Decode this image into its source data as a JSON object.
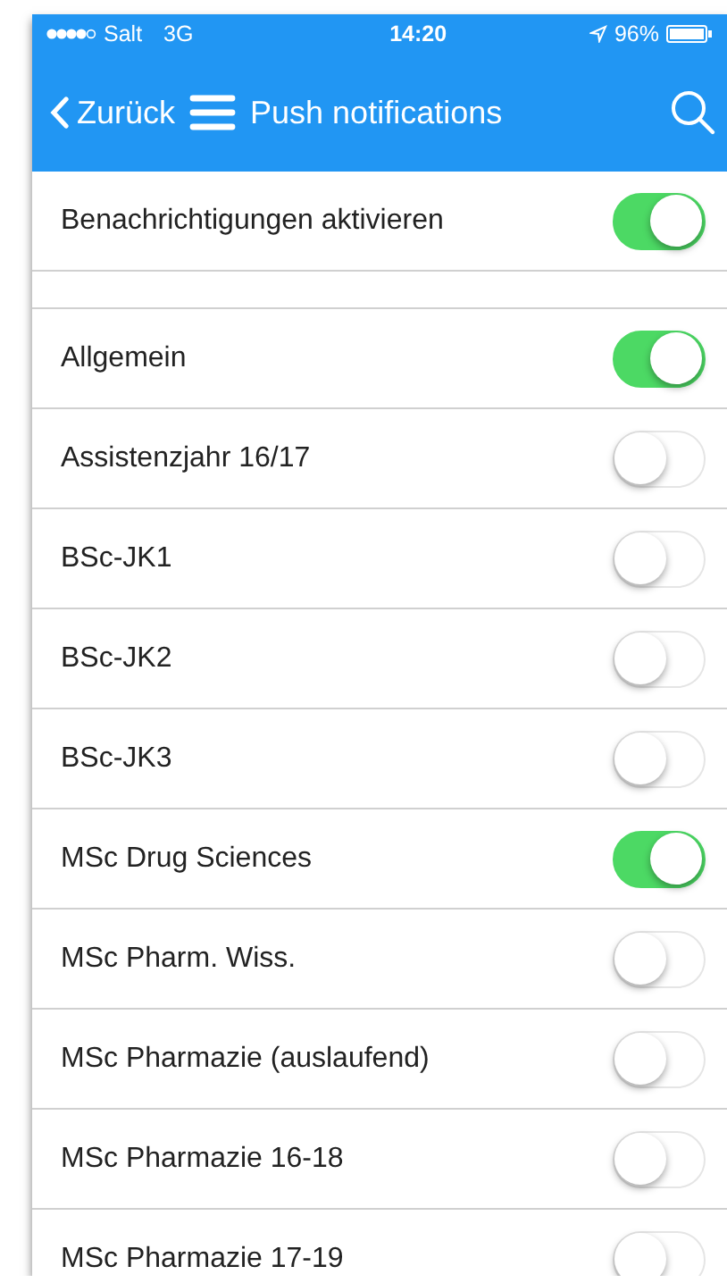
{
  "status_bar": {
    "carrier": "Salt",
    "network": "3G",
    "time": "14:20",
    "battery": "96%"
  },
  "header": {
    "back": "Zurück",
    "title": "Push notifications"
  },
  "master": {
    "label": "Benachrichtigungen aktivieren",
    "on": true
  },
  "channels": [
    {
      "label": "Allgemein",
      "on": true
    },
    {
      "label": "Assistenzjahr 16/17",
      "on": false
    },
    {
      "label": "BSc-JK1",
      "on": false
    },
    {
      "label": "BSc-JK2",
      "on": false
    },
    {
      "label": "BSc-JK3",
      "on": false
    },
    {
      "label": "MSc Drug Sciences",
      "on": true
    },
    {
      "label": "MSc Pharm. Wiss.",
      "on": false
    },
    {
      "label": "MSc Pharmazie (auslaufend)",
      "on": false
    },
    {
      "label": "MSc Pharmazie 16-18",
      "on": false
    },
    {
      "label": "MSc Pharmazie 17-19",
      "on": false
    }
  ]
}
